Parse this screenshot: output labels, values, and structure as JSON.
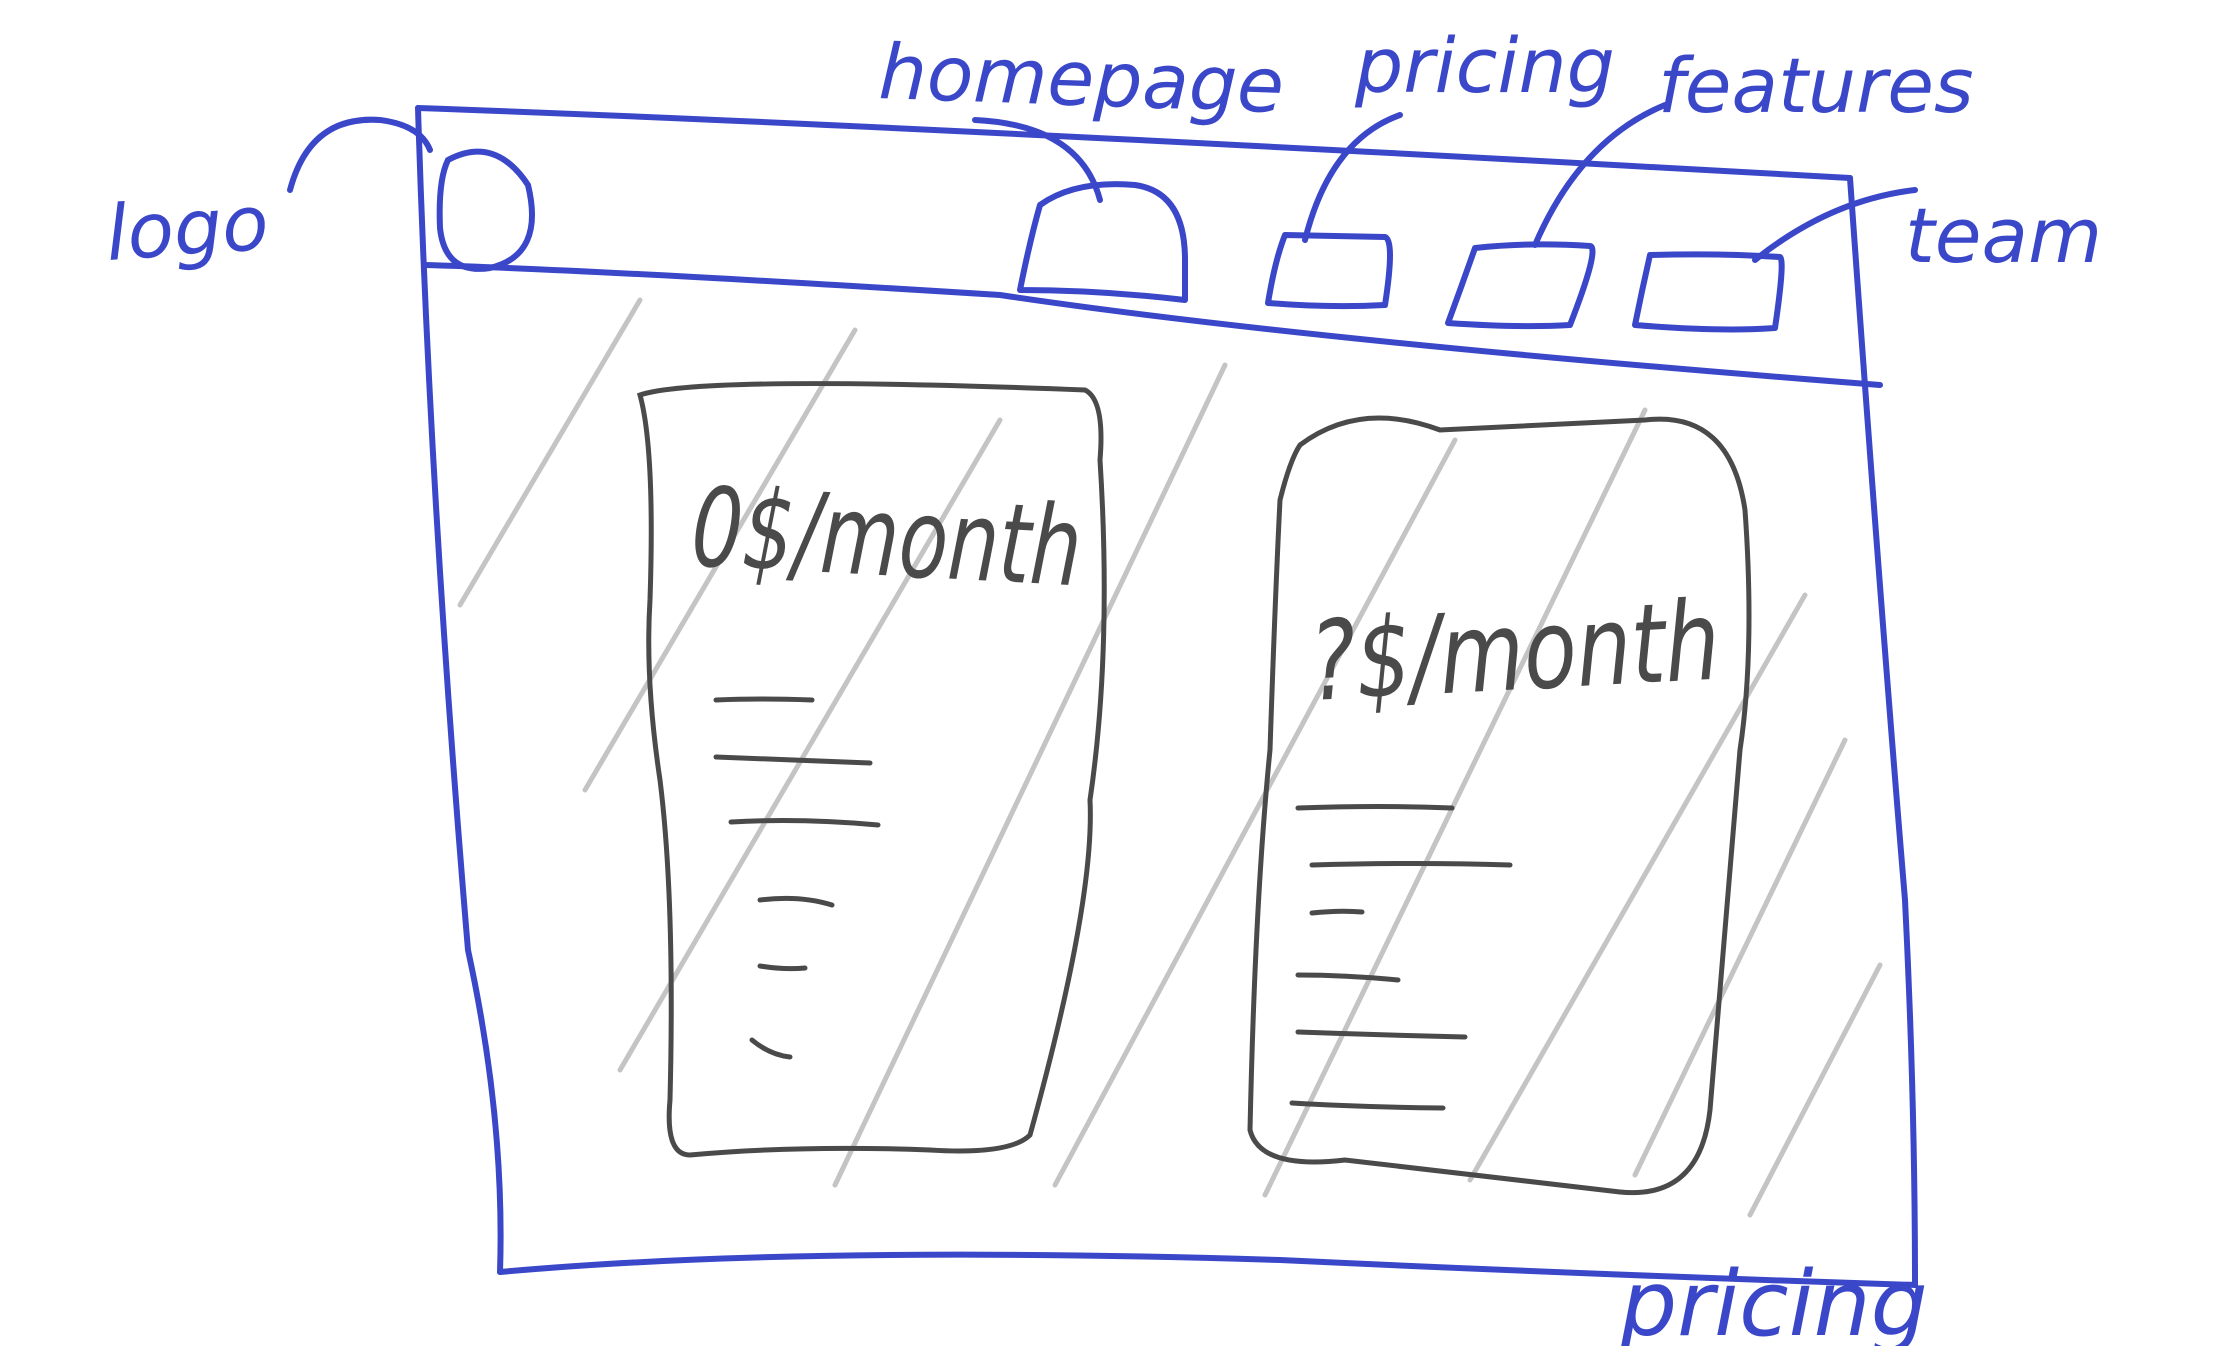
{
  "annotations": {
    "logo": "logo",
    "homepage": "homepage",
    "pricing": "pricing",
    "features": "features",
    "team": "team",
    "page_name": "pricing"
  },
  "plans": [
    {
      "price": "0$/month"
    },
    {
      "price": "?$/month"
    }
  ],
  "colors": {
    "annotation_ink": "#3b47c9",
    "wireframe_ink": "#4a4a4a",
    "hatch": "#c4c4c4"
  }
}
